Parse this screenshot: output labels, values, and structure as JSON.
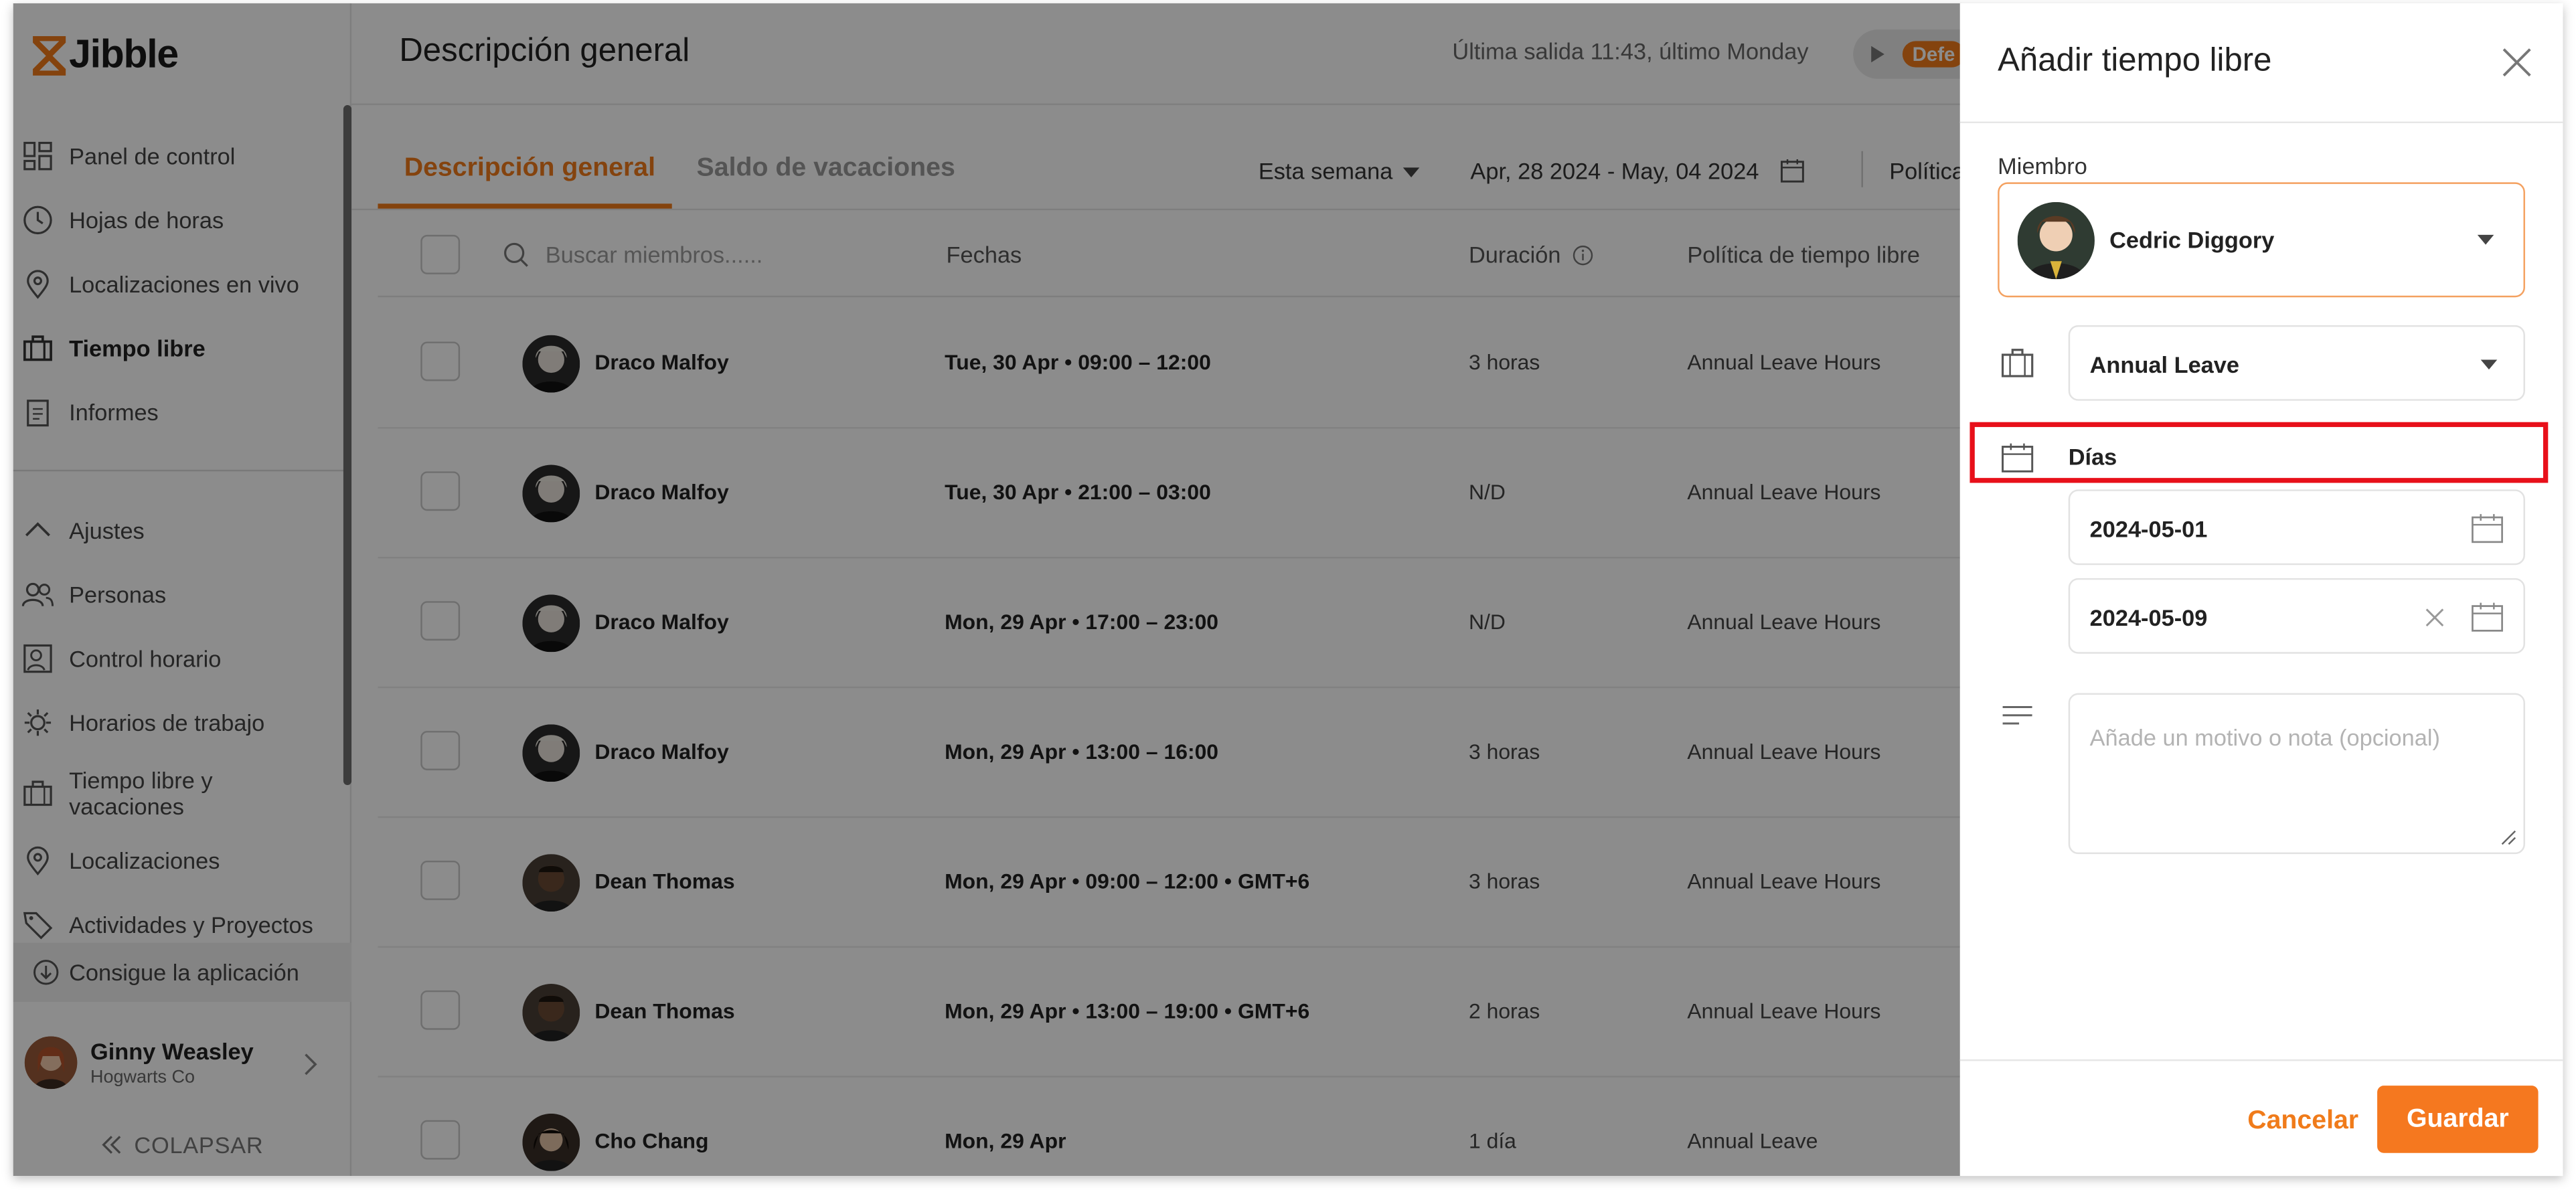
{
  "app": {
    "logo_text": "Jibble",
    "brand_color": "#f07b1a"
  },
  "sidebar": {
    "items": [
      {
        "label": "Panel de control",
        "icon": "dashboard-icon"
      },
      {
        "label": "Hojas de horas",
        "icon": "clock-icon"
      },
      {
        "label": "Localizaciones en vivo",
        "icon": "location-pin-icon"
      },
      {
        "label": "Tiempo libre",
        "icon": "suitcase-icon",
        "active": true
      },
      {
        "label": "Informes",
        "icon": "report-icon"
      },
      {
        "label": "Ajustes",
        "icon": "chevron-up-icon"
      },
      {
        "label": "Personas",
        "icon": "people-icon"
      },
      {
        "label": "Control horario",
        "icon": "time-tracking-icon"
      },
      {
        "label": "Horarios de trabajo",
        "icon": "gear-schedule-icon"
      },
      {
        "label": "Tiempo libre y\nvacaciones",
        "icon": "suitcase-icon"
      },
      {
        "label": "Localizaciones",
        "icon": "location-pin-icon"
      },
      {
        "label": "Actividades y Proyectos",
        "icon": "tag-icon"
      }
    ],
    "get_app": "Consigue la aplicación",
    "user": {
      "name": "Ginny Weasley",
      "org": "Hogwarts Co"
    },
    "collapse": "COLAPSAR"
  },
  "header": {
    "title": "Descripción general",
    "last_out": "Última salida 11:43, último Monday",
    "pill_text": "Defe"
  },
  "tabs": [
    {
      "label": "Descripción general",
      "active": true
    },
    {
      "label": "Saldo de vacaciones",
      "active": false
    }
  ],
  "filters": {
    "period": "Esta semana",
    "date_range": "Apr, 28 2024 - May, 04 2024",
    "policy_cut": "Política"
  },
  "table": {
    "search_placeholder": "Buscar miembros......",
    "columns": [
      "Fechas",
      "Duración",
      "Política de tiempo libre"
    ],
    "rows": [
      {
        "name": "Draco Malfoy",
        "dates": "Tue, 30 Apr • 09:00 – 12:00",
        "duration": "3 horas",
        "policy": "Annual Leave Hours"
      },
      {
        "name": "Draco Malfoy",
        "dates": "Tue, 30 Apr • 21:00 – 03:00",
        "duration": "N/D",
        "policy": "Annual Leave Hours"
      },
      {
        "name": "Draco Malfoy",
        "dates": "Mon, 29 Apr • 17:00 – 23:00",
        "duration": "N/D",
        "policy": "Annual Leave Hours"
      },
      {
        "name": "Draco Malfoy",
        "dates": "Mon, 29 Apr • 13:00 – 16:00",
        "duration": "3 horas",
        "policy": "Annual Leave Hours"
      },
      {
        "name": "Dean Thomas",
        "dates": "Mon, 29 Apr • 09:00 – 12:00 • GMT+6",
        "duration": "3 horas",
        "policy": "Annual Leave Hours"
      },
      {
        "name": "Dean Thomas",
        "dates": "Mon, 29 Apr • 13:00 – 19:00 • GMT+6",
        "duration": "2 horas",
        "policy": "Annual Leave Hours"
      },
      {
        "name": "Cho Chang",
        "dates": "Mon, 29 Apr",
        "duration": "1 día",
        "policy": "Annual Leave"
      }
    ]
  },
  "drawer": {
    "title": "Añadir tiempo libre",
    "member_label": "Miembro",
    "member_name": "Cedric Diggory",
    "leave_type": "Annual Leave",
    "days_label": "Días",
    "start_date": "2024-05-01",
    "end_date": "2024-05-09",
    "note_placeholder": "Añade un motivo o nota (opcional)",
    "cancel": "Cancelar",
    "save": "Guardar"
  }
}
